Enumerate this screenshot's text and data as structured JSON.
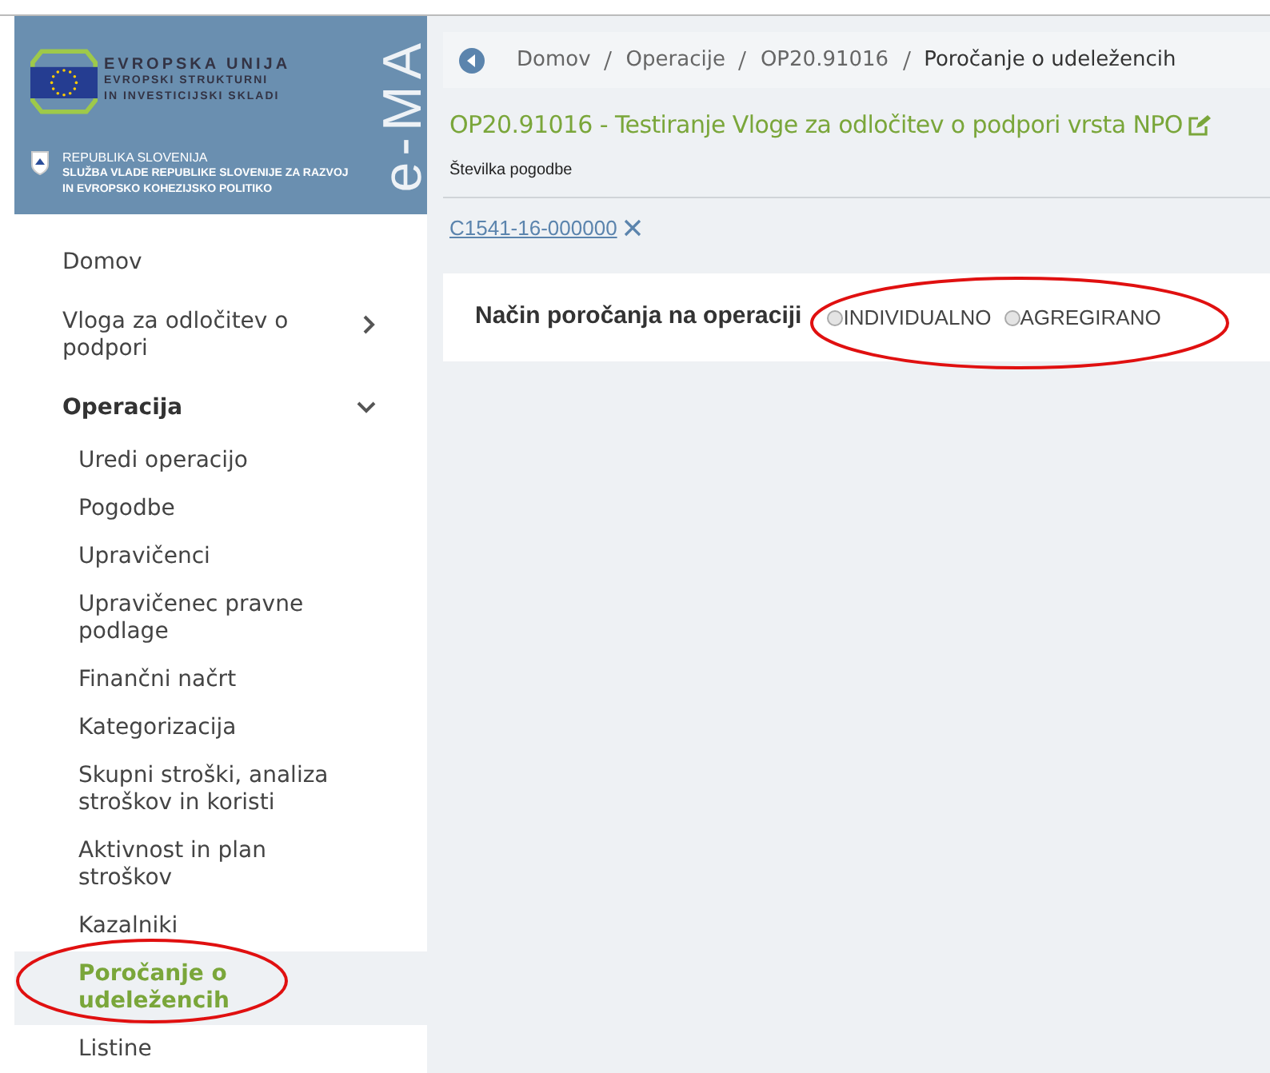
{
  "logo": {
    "eu_title": "EVROPSKA UNIJA",
    "eu_line_1": "EVROPSKI STRUKTURNI",
    "eu_line_2": "IN INVESTICIJSKI SKLADI",
    "rs_title": "REPUBLIKA SLOVENIJA",
    "rs_line_1": "SLUŽBA VLADE REPUBLIKE SLOVENIJE ZA RAZVOJ",
    "rs_line_2": "IN EVROPSKO KOHEZIJSKO POLITIKO",
    "app_name": "e-MA"
  },
  "sidebar": {
    "items": [
      {
        "label": "Domov",
        "selected": false
      },
      {
        "label": "Vloga za odločitev o podpori",
        "selected": false,
        "expanded": false
      },
      {
        "label": "Operacija",
        "selected": false,
        "expanded": true,
        "children": [
          {
            "label": "Uredi operacijo",
            "selected": false
          },
          {
            "label": "Pogodbe",
            "selected": false
          },
          {
            "label": "Upravičenci",
            "selected": false
          },
          {
            "label": "Upravičenec pravne podlage",
            "selected": false
          },
          {
            "label": "Finančni načrt",
            "selected": false
          },
          {
            "label": "Kategorizacija",
            "selected": false
          },
          {
            "label": "Skupni stroški, analiza stroškov in koristi",
            "selected": false
          },
          {
            "label": "Aktivnost in plan stroškov",
            "selected": false
          },
          {
            "label": "Kazalniki",
            "selected": false
          },
          {
            "label": "Poročanje o udeležencih",
            "selected": true
          },
          {
            "label": "Listine",
            "selected": false
          }
        ]
      }
    ]
  },
  "breadcrumb": [
    "Domov",
    "Operacije",
    "OP20.91016",
    "Poročanje o udeležencih"
  ],
  "title": "OP20.91016 - Testiranje Vloge za odločitev o podpori vrsta NPO",
  "contract_label": "Številka pogodbe",
  "contract_link": "C1541-16-000000",
  "reporting": {
    "label": "Način poročanja na operaciji",
    "options": [
      {
        "label": "INDIVIDUALNO",
        "selected": false
      },
      {
        "label": "AGREGIRANO",
        "selected": false
      }
    ]
  }
}
